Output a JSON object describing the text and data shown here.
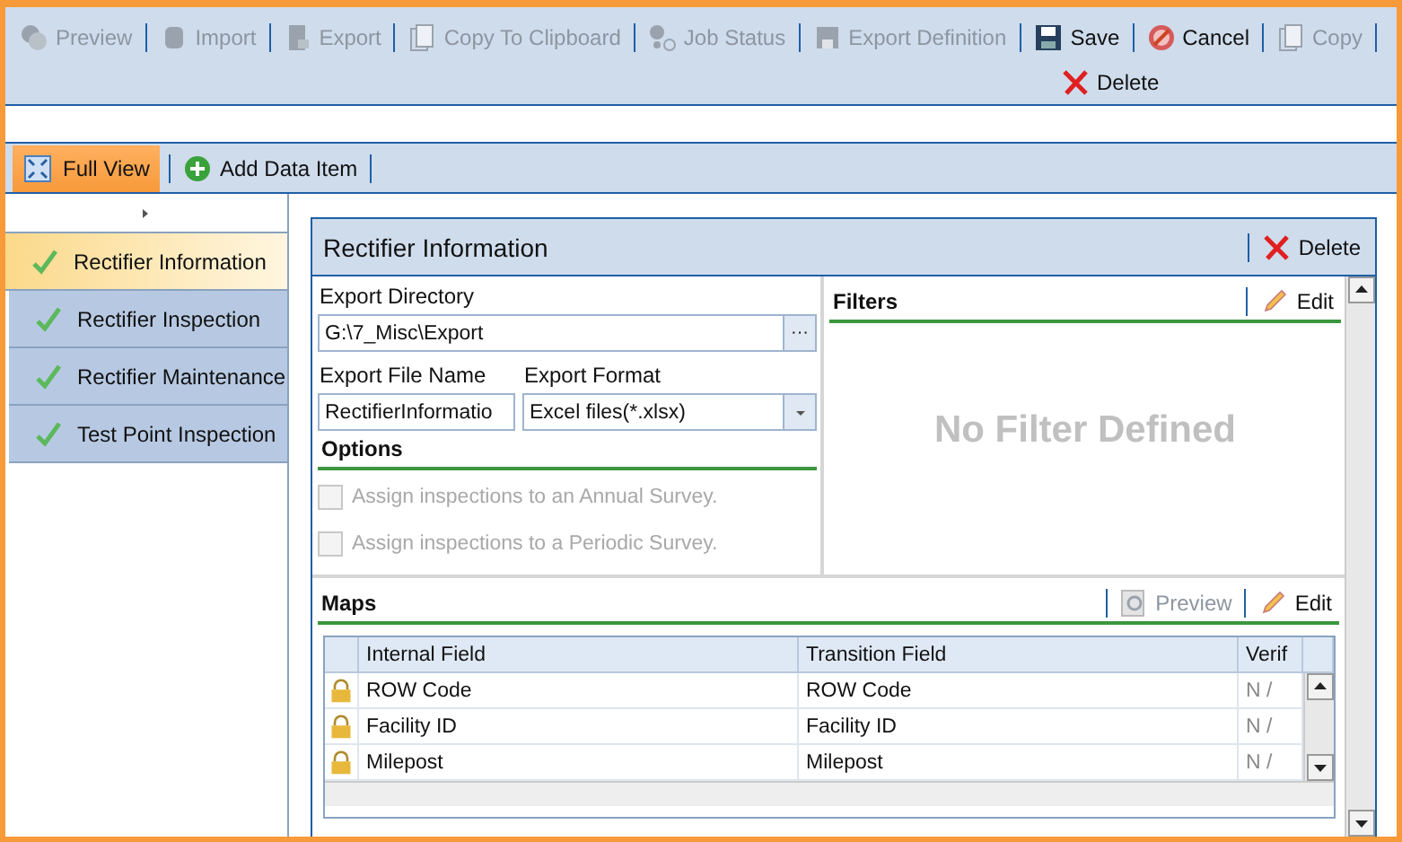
{
  "toolbar": {
    "items": [
      {
        "label": "Preview",
        "disabled": true
      },
      {
        "label": "Import",
        "disabled": true
      },
      {
        "label": "Export",
        "disabled": true
      },
      {
        "label": "Copy To Clipboard",
        "disabled": true
      },
      {
        "label": "Job Status",
        "disabled": true
      },
      {
        "label": "Export Definition",
        "disabled": true
      }
    ],
    "actions": [
      {
        "label": "Save",
        "disabled": false
      },
      {
        "label": "Cancel",
        "disabled": false
      },
      {
        "label": "Copy",
        "disabled": true
      }
    ],
    "delete": {
      "label": "Delete"
    }
  },
  "view_bar": {
    "full_view": {
      "label": "Full View",
      "selected": true
    },
    "add": {
      "label": "Add Data Item"
    }
  },
  "sidebar": {
    "items": [
      {
        "label": "Rectifier Information",
        "selected": true
      },
      {
        "label": "Rectifier Inspection",
        "selected": false
      },
      {
        "label": "Rectifier Maintenance",
        "selected": false
      },
      {
        "label": "Test Point Inspection",
        "selected": false
      }
    ]
  },
  "panel": {
    "title": "Rectifier Information",
    "delete": "Delete",
    "export_directory": {
      "label": "Export Directory",
      "value": "G:\\7_Misc\\Export",
      "browse": "···"
    },
    "export_file_name": {
      "label": "Export File Name",
      "value": "RectifierInformatio"
    },
    "export_format": {
      "label": "Export Format",
      "value": "Excel files(*.xlsx)"
    },
    "options": {
      "title": "Options",
      "items": [
        {
          "label": "Assign inspections to an Annual Survey.",
          "checked": false,
          "disabled": true
        },
        {
          "label": "Assign inspections to a Periodic Survey.",
          "checked": false,
          "disabled": true
        }
      ]
    },
    "filters": {
      "title": "Filters",
      "edit": "Edit",
      "empty": "No Filter Defined"
    },
    "maps": {
      "title": "Maps",
      "preview": {
        "label": "Preview",
        "disabled": true
      },
      "edit": "Edit",
      "columns": [
        "Internal Field",
        "Transition Field",
        "Verif"
      ],
      "rows": [
        {
          "locked": true,
          "cells": [
            "ROW Code",
            "ROW Code",
            "N /"
          ]
        },
        {
          "locked": true,
          "cells": [
            "Facility ID",
            "Facility ID",
            "N /"
          ]
        },
        {
          "locked": true,
          "cells": [
            "Milepost",
            "Milepost",
            "N /"
          ]
        }
      ]
    }
  }
}
